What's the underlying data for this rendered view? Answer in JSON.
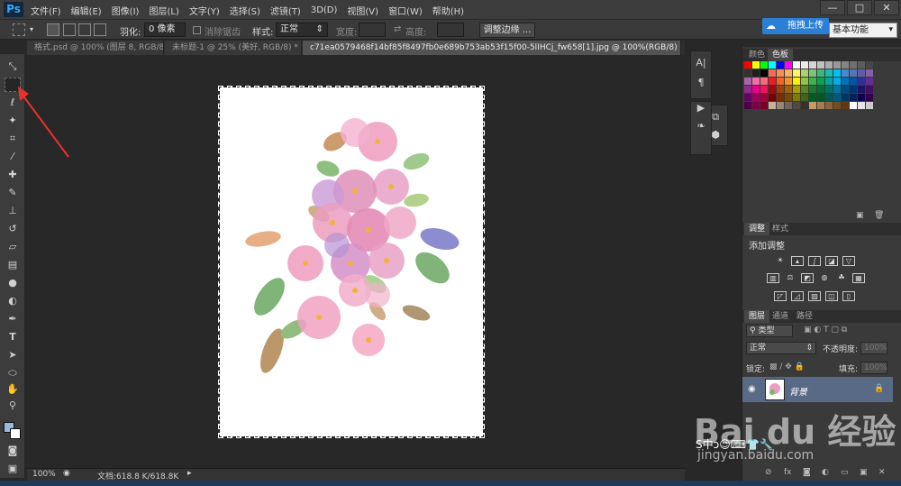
{
  "app": {
    "logo": "Ps",
    "menu": [
      "文件(F)",
      "编辑(E)",
      "图像(I)",
      "图层(L)",
      "文字(Y)",
      "选择(S)",
      "滤镜(T)",
      "3D(D)",
      "视图(V)",
      "窗口(W)",
      "帮助(H)"
    ],
    "window_buttons": [
      "—",
      "□",
      "✕"
    ]
  },
  "options_bar": {
    "feather_label": "羽化:",
    "feather_value": "0 像素",
    "antialias_label": "消除锯齿",
    "style_label": "样式:",
    "style_value": "正常",
    "width_label": "宽度:",
    "height_label": "高度:",
    "refine_button": "调整边缘 ...",
    "upload_button": "拖拽上传",
    "workspace_value": "基本功能"
  },
  "tabs": [
    {
      "label": "格式.psd @ 100% (图层 8, RGB/8) ×",
      "active": false
    },
    {
      "label": "未标题-1 @ 25% (美好, RGB/8) * ×",
      "active": false
    },
    {
      "label": "c71ea0579468f14bf85f8497fb0e689b753ab53f15f00-5lIHCj_fw658[1].jpg @ 100%(RGB/8) * ×",
      "active": true
    }
  ],
  "status": {
    "zoom": "100%",
    "doc_info": "文档:618.8 K/618.8K"
  },
  "panels": {
    "swatch_tabs": [
      "颜色",
      "色板"
    ],
    "adjust_tabs": [
      "调整",
      "样式"
    ],
    "adjust_title": "添加调整",
    "layer_tabs": [
      "图层",
      "通道",
      "路径"
    ],
    "kind_label": "类型",
    "blend_mode": "正常",
    "opacity_label": "不透明度:",
    "opacity_value": "100%",
    "lock_label": "锁定:",
    "fill_label": "填充:",
    "fill_value": "100%",
    "layer_name": "背景"
  },
  "watermark": {
    "brand": "Bai du 经验",
    "url": "jingyan.baidu.com"
  },
  "colors": {
    "accent_blue": "#2b7fd4",
    "selected_layer": "#586a85",
    "foreground": "#9bb8de",
    "background": "#ffffff",
    "arrow": "#e8322e"
  }
}
